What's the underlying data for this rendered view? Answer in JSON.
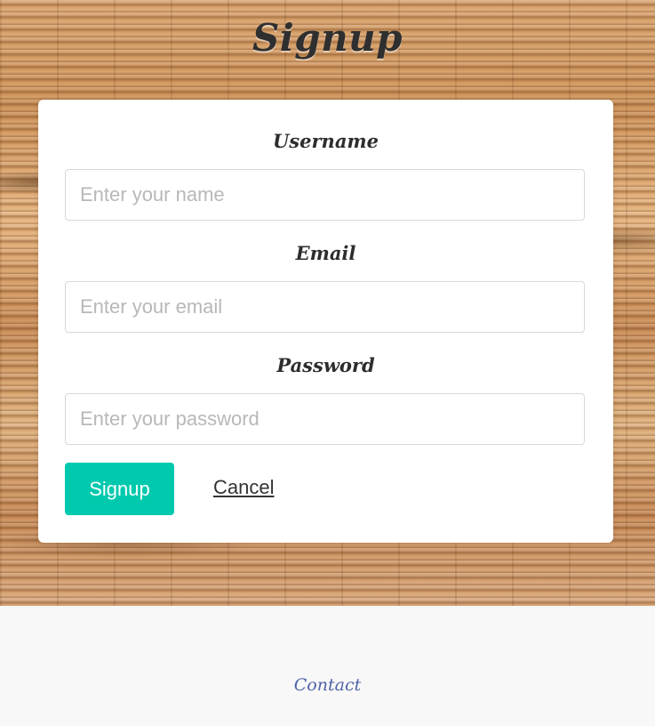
{
  "page": {
    "title": "Signup"
  },
  "form": {
    "username": {
      "label": "Username",
      "placeholder": "Enter your name",
      "value": ""
    },
    "email": {
      "label": "Email",
      "placeholder": "Enter your email",
      "value": ""
    },
    "password": {
      "label": "Password",
      "placeholder": "Enter your password",
      "value": ""
    },
    "actions": {
      "submit_label": "Signup",
      "cancel_label": "Cancel"
    }
  },
  "footer": {
    "contact_label": "Contact"
  },
  "colors": {
    "accent": "#00c9ad",
    "card_background": "#ffffff",
    "footer_background": "#f8f8f8",
    "link_blue": "#4f63a8",
    "text_dark": "#2d2d2d"
  }
}
